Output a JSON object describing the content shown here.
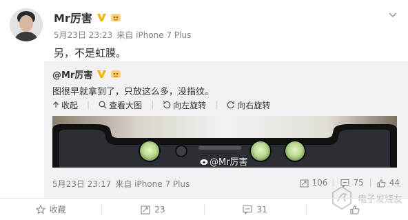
{
  "post": {
    "author": "Mr厉害",
    "date": "5月23日 23:23",
    "source": "来自 iPhone 7 Plus",
    "text": "另，不是虹膜。"
  },
  "repost": {
    "author": "@Mr厉害",
    "text": "图很早就拿到了，只放这么多，没指纹。",
    "tools": {
      "collapse": "收起",
      "view_large": "查看大图",
      "rotate_left": "向左旋转",
      "rotate_right": "向右旋转"
    },
    "watermark": "@Mr厉害",
    "date": "5月23日 23:17",
    "source": "来自 iPhone 7 Plus",
    "reposts": "106",
    "comments": "75",
    "likes": "44"
  },
  "actions": {
    "favorite": "收藏",
    "repost_count": "23",
    "comment_count": "31"
  },
  "site_watermark": "电子发烧友",
  "colors": {
    "repost_bg": "#f2f2f5",
    "vip_gold": "#f5b300",
    "meta_gray": "#808080"
  }
}
